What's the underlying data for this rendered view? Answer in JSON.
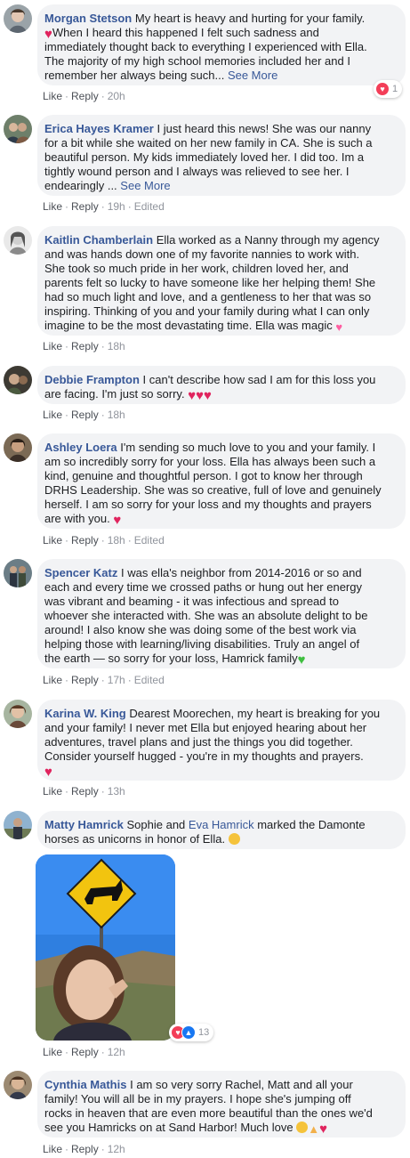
{
  "colors": {
    "link": "#385898",
    "bubble": "#f2f3f5",
    "meta": "#90949c",
    "heart": "#e0245e",
    "love_reaction": "#f33e58",
    "like_reaction": "#1877f2"
  },
  "labels": {
    "like": "Like",
    "reply": "Reply",
    "edited": "Edited",
    "see_more": "See More"
  },
  "comments": [
    {
      "author": "Morgan Stetson",
      "lines": [
        "My heart is heavy and hurting for your family.",
        "When I heard this happened I felt such sadness and",
        "immediately thought back to everything I experienced with Ella.",
        "The majority of my high school memories included her and I",
        "remember her always being such..."
      ],
      "time": "20h",
      "reactions": {
        "icons": [
          "love"
        ],
        "count": "1"
      }
    },
    {
      "author": "Erica Hayes Kramer",
      "lines": [
        "I just heard this news! She was our nanny",
        "for a bit while she waited on her new family in CA. She is such a",
        "beautiful person. My kids immediately loved her. I did too. Im a",
        "tightly wound person and I always was relieved to see her. I",
        "endearingly ..."
      ],
      "time": "19h",
      "edited": true
    },
    {
      "author": "Kaitlin Chamberlain",
      "lines": [
        "Ella worked as a Nanny through my agency",
        "and was hands down one of my favorite nannies to work with.",
        "She took so much pride in her work, children loved her, and",
        "parents felt so lucky to have someone like her helping them! She",
        "had so much light and love, and a gentleness to her that was so",
        "inspiring. Thinking of you and your family during what I can only",
        "imagine to be the most devastating time. Ella was magic"
      ],
      "time": "18h"
    },
    {
      "author": "Debbie Frampton",
      "lines": [
        "I can't describe how sad I am for this loss you",
        "are facing. I'm just so sorry."
      ],
      "time": "18h"
    },
    {
      "author": "Ashley Loera",
      "lines": [
        "I'm sending so much love to you and your family. I",
        "am so incredibly sorry for your loss. Ella has always been such a",
        "kind, genuine and thoughtful person. I got to know her through",
        "DRHS Leadership. She was so creative, full of love and genuinely",
        "herself. I am so sorry for your loss and my thoughts and prayers",
        "are with you."
      ],
      "time": "18h",
      "edited": true
    },
    {
      "author": "Spencer Katz",
      "lines": [
        "I was ella's neighbor from 2014-2016 or so and",
        "each and every time we crossed paths or hung out her energy",
        "was vibrant and beaming - it was infectious and spread to",
        "whoever she interacted with. She was an absolute delight to be",
        "around! I also know she was doing some of the best work via",
        "helping those with learning/living disabilities. Truly an angel of",
        "the earth — so sorry for your loss, Hamrick family"
      ],
      "time": "17h",
      "edited": true
    },
    {
      "author": "Karina W. King",
      "lines": [
        "Dearest Moorechen, my heart is breaking for you",
        "and your family! I never met Ella but enjoyed hearing about her",
        "adventures, travel plans and just the things you did together.",
        "Consider yourself hugged - you're in my thoughts and prayers."
      ],
      "time": "13h"
    },
    {
      "author": "Matty Hamrick",
      "line1_pre": "Sophie and",
      "mention": "Eva Hamrick",
      "line1_post": "marked the Damonte",
      "line2": "horses as unicorns in honor of Ella.",
      "time": "12h",
      "reactions": {
        "icons": [
          "love",
          "like"
        ],
        "count": "13"
      }
    },
    {
      "author": "Cynthia Mathis",
      "lines": [
        "I am so very sorry Rachel, Matt and all your",
        "family! You will all be in my prayers. I hope she's jumping off",
        "rocks in heaven that are even more beautiful than the ones we'd",
        "see you Hamricks on at Sand Harbor! Much love"
      ],
      "time": "12h"
    }
  ]
}
